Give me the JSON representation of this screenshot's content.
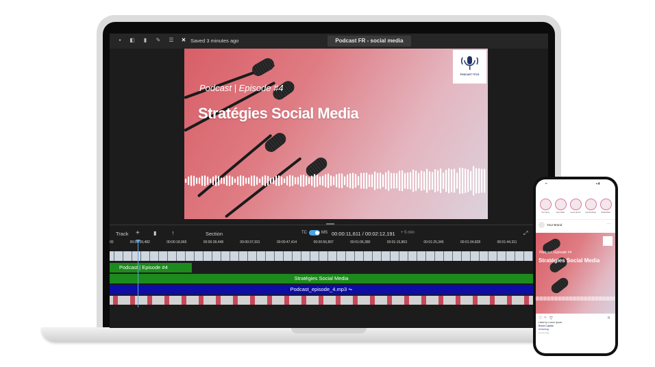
{
  "editor": {
    "toolbar": {
      "icons": [
        "save-icon",
        "share-icon",
        "export-icon",
        "edit-icon",
        "list-icon",
        "close-icon"
      ],
      "saved_status": "Saved 3 minutes ago",
      "project_title": "Podcast FR - social media"
    },
    "preview": {
      "episode_text": "Podcast | Episode #4",
      "title_text": "Stratégies Social Media",
      "logo_text": "PODCAST TITLE"
    },
    "timeline": {
      "track_label": "Track",
      "section_label": "Section",
      "toggle_left": "TC",
      "toggle_right": "MS",
      "timecode": "00:00:11,611 / 00:02:12,191",
      "zoom_label": "+ 5 min",
      "ruler": [
        "00",
        "00:00:09,482",
        "00:00:18,965",
        "00:00:28,448",
        "00:00:37,931",
        "00:00:47,414",
        "00:00:56,897",
        "00:01:06,380",
        "00:01:15,863",
        "00:01:25,345",
        "00:01:34,828",
        "00:01:44,311"
      ],
      "tracks": {
        "episode": "Podcast | Episode #4",
        "title": "Stratégies Social Media",
        "audio": "Podcast_episode_4.mp3"
      }
    },
    "colors": {
      "green_track": "#1d8a1d",
      "blue_track": "#0d0da5",
      "accent": "#5aa9e6"
    }
  },
  "phone": {
    "stories": [
      "Your Story",
      "Liam Maier",
      "Laura Hunter",
      "Camila Wang",
      "Sheila Bratt"
    ],
    "brand": "Your Brand",
    "post_episode": "Podcast | Episode #4",
    "post_title": "Stratégies Social Media",
    "likes": "Liked by Lorem Ipsum",
    "caption": "Brand Caption",
    "hashtag": "#Hashtag",
    "time": "2 hours ago"
  }
}
